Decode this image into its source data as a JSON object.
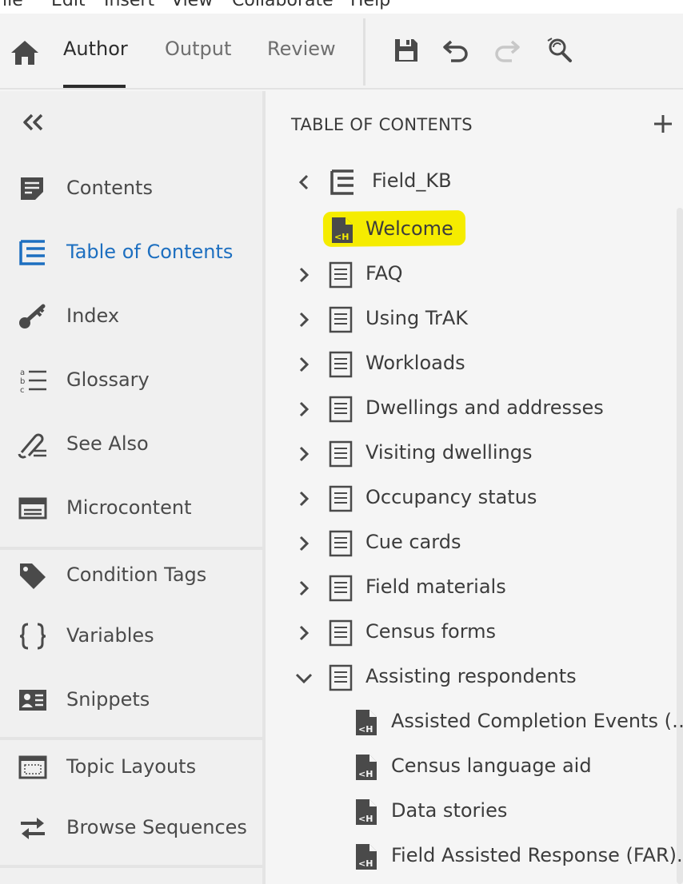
{
  "menu": [
    "File",
    "Edit",
    "Insert",
    "View",
    "Collaborate",
    "Help"
  ],
  "toolbar": {
    "tabs": [
      "Author",
      "Output",
      "Review"
    ],
    "active_tab": "Author"
  },
  "sidebar": {
    "items": [
      {
        "label": "Contents",
        "icon": "contents-icon"
      },
      {
        "label": "Table of Contents",
        "icon": "toc-icon",
        "active": true
      },
      {
        "label": "Index",
        "icon": "key-icon"
      },
      {
        "label": "Glossary",
        "icon": "glossary-icon"
      },
      {
        "label": "See Also",
        "icon": "see-also-icon"
      },
      {
        "label": "Microcontent",
        "icon": "microcontent-icon"
      },
      {
        "label": "Condition Tags",
        "icon": "tag-icon"
      },
      {
        "label": "Variables",
        "icon": "braces-icon"
      },
      {
        "label": "Snippets",
        "icon": "snippet-icon"
      },
      {
        "label": "Topic Layouts",
        "icon": "layout-icon"
      },
      {
        "label": "Browse Sequences",
        "icon": "sequence-icon"
      }
    ]
  },
  "toc": {
    "title": "TABLE OF CONTENTS",
    "root": "Field_KB",
    "welcome": "Welcome",
    "books": [
      "FAQ",
      "Using TrAK",
      "Workloads",
      "Dwellings and addresses",
      "Visiting dwellings",
      "Occupancy status",
      "Cue cards",
      "Field materials",
      "Census forms",
      "Assisting respondents"
    ],
    "children": [
      "Assisted Completion Events (…",
      "Census language aid",
      "Data stories",
      "Field Assisted Response (FAR).."
    ]
  },
  "colors": {
    "accent": "#1d6fc0",
    "highlight": "#f5ec00",
    "text": "#3c3c3c"
  }
}
